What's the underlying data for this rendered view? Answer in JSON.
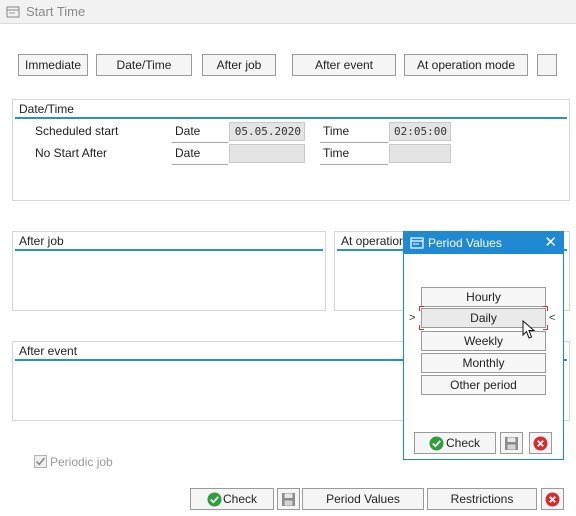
{
  "window": {
    "title": "Start Time"
  },
  "toolbar": {
    "immediate": "Immediate",
    "date_time": "Date/Time",
    "after_job": "After job",
    "after_event": "After event",
    "at_operation_mode": "At operation mode"
  },
  "date_time_group": {
    "title": "Date/Time",
    "scheduled_start_label": "Scheduled start",
    "no_start_after_label": "No Start After",
    "date_label": "Date",
    "time_label": "Time",
    "scheduled_start_date": "05.05.2020",
    "scheduled_start_time": "02:05:00",
    "no_start_after_date": "",
    "no_start_after_time": ""
  },
  "after_job_group": {
    "title": "After job"
  },
  "at_operation_group": {
    "title": "At operation mode"
  },
  "after_event_group": {
    "title": "After event"
  },
  "periodic_job": {
    "label": "Periodic job",
    "checked": true
  },
  "footer": {
    "check": "Check",
    "period_values": "Period Values",
    "restrictions": "Restrictions"
  },
  "popup": {
    "title": "Period Values",
    "options": [
      "Hourly",
      "Daily",
      "Weekly",
      "Monthly",
      "Other period"
    ],
    "selected": "Daily",
    "check": "Check"
  },
  "colors": {
    "accent": "#1f8ad2",
    "group_line": "#2d8ec9",
    "check_green": "#2e9e3e",
    "cancel_red": "#d22e2e"
  },
  "icons": [
    "window-icon",
    "checkmark-icon",
    "save-icon",
    "cancel-icon",
    "close-icon",
    "mouse-cursor-icon"
  ]
}
